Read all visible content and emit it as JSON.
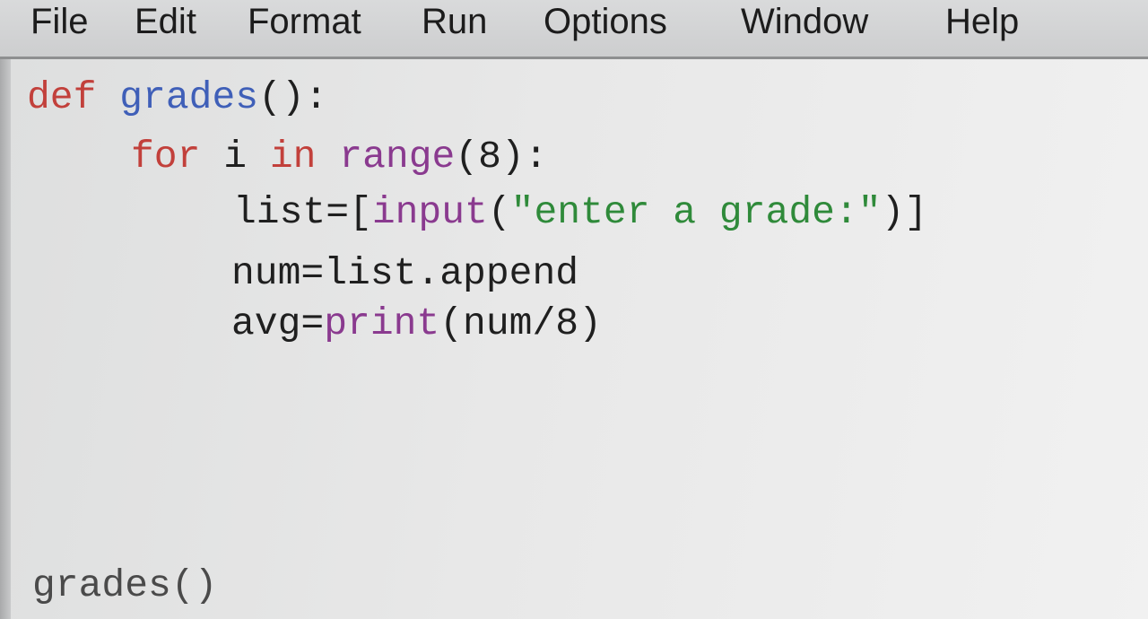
{
  "menu": {
    "items": [
      "File",
      "Edit",
      "Format",
      "Run",
      "Options",
      "Window",
      "Help"
    ]
  },
  "code": {
    "line1": {
      "kw": "def",
      "name": "grades",
      "tail": "():"
    },
    "line2": {
      "kw1": "for",
      "var": "i",
      "kw2": "in",
      "call": "range",
      "tail": "(8):"
    },
    "line3": {
      "lhs": "list=[",
      "call": "input",
      "open": "(",
      "str": "\"enter a grade:\"",
      "close": ")]"
    },
    "line4": {
      "text": "num=list.append"
    },
    "line5": {
      "lhs": "avg=",
      "call": "print",
      "tail": "(num/8)"
    },
    "call_line": {
      "text": "grades()"
    }
  },
  "colors": {
    "keyword": "#c2403b",
    "definition": "#3f5fb8",
    "builtin": "#8a3a8f",
    "string": "#2f8a3a",
    "text": "#1f1f1f"
  }
}
